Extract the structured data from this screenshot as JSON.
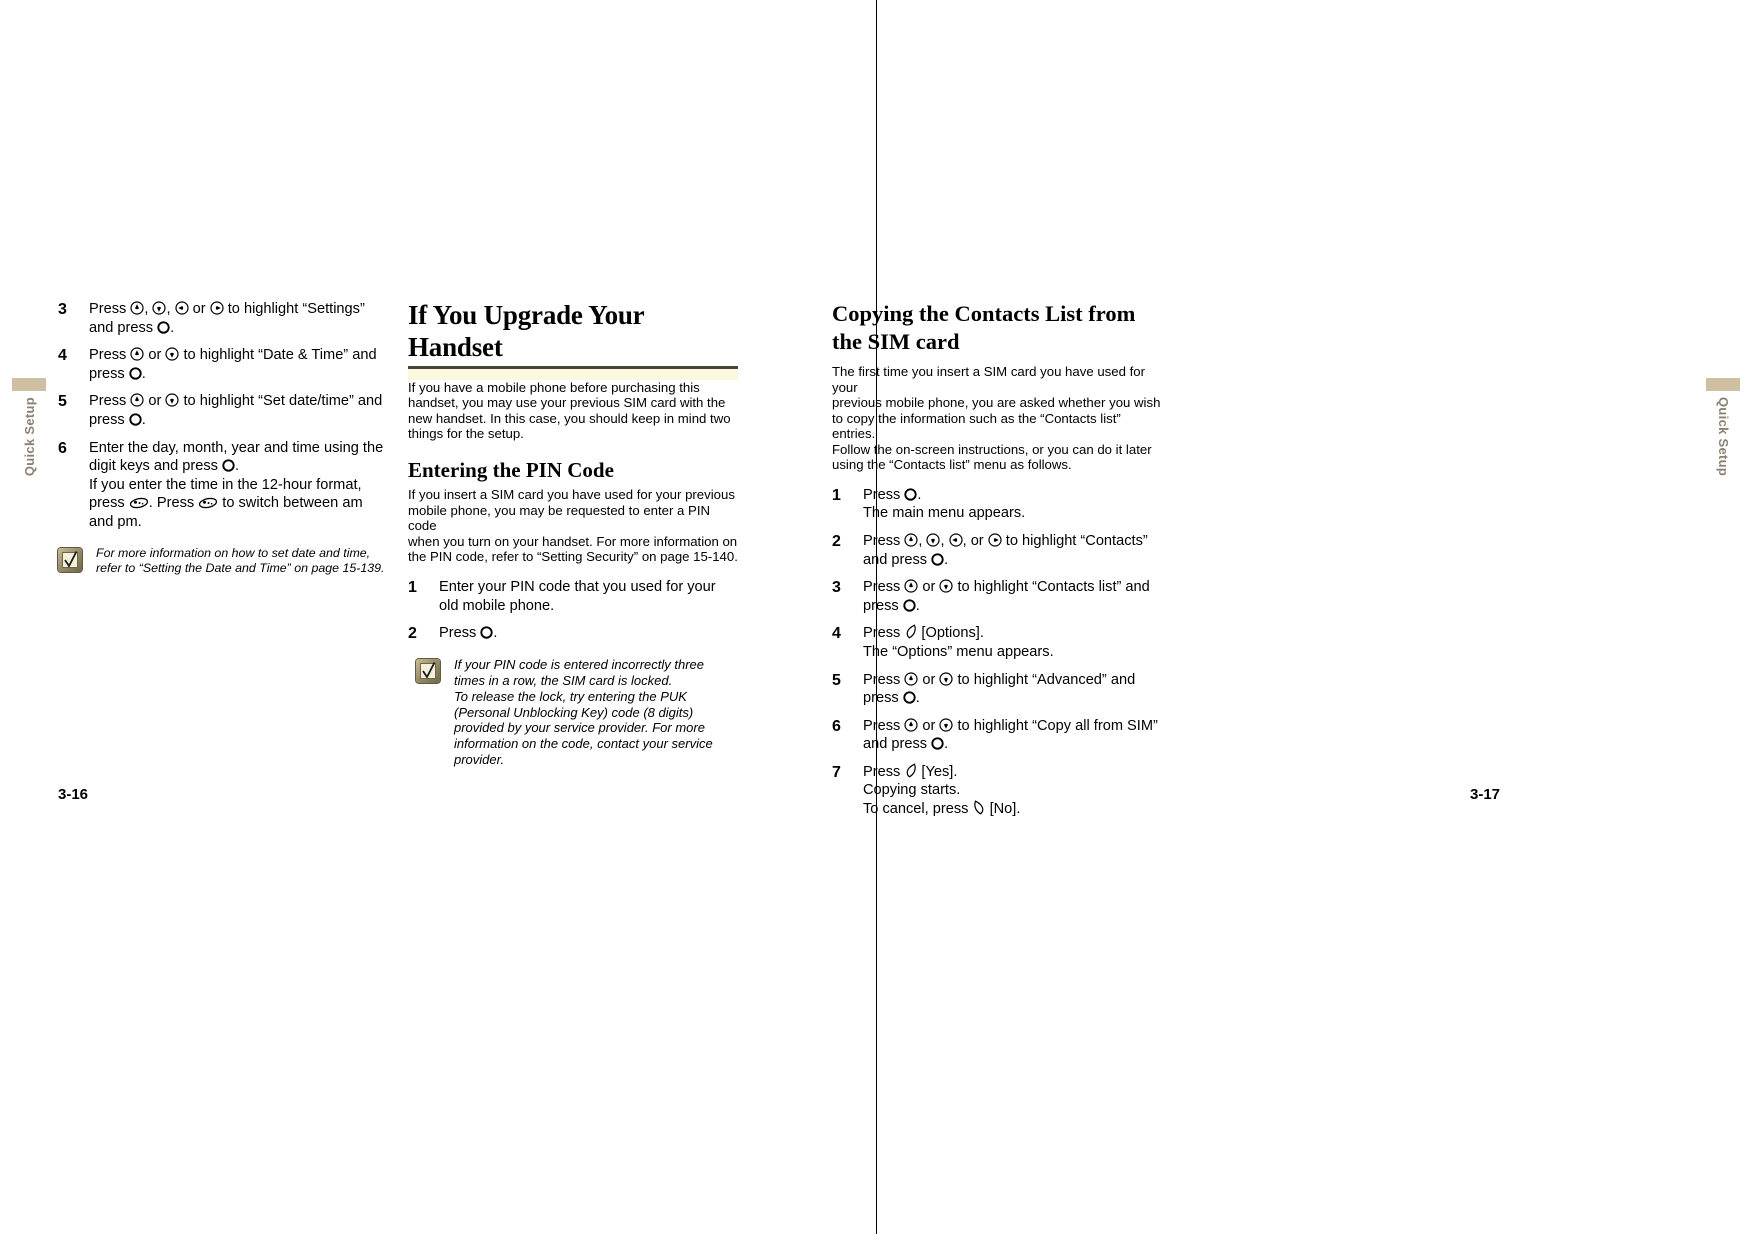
{
  "document": {
    "type": "printed-manual-spread",
    "thumb_tab_label": "Quick Setup",
    "thumb_tab_color": "#cfc0a4",
    "accent_rule_color": "#4a4433",
    "accent_band_color": "#fcf8e0",
    "left_page_number": "3-16",
    "right_page_number": "3-17"
  },
  "left_page": {
    "column_a": {
      "steps": [
        {
          "number": "3",
          "lines": [
            "Press ⓘ, ⓘ, ⓘ or ⓘ to highlight “Settings”",
            "and press ○."
          ],
          "text": "Press [up], [down], [left] or [right] to highlight “Settings” and press [center]."
        },
        {
          "number": "4",
          "text": "Press [up] or [down] to highlight “Date & Time” and press [center]."
        },
        {
          "number": "5",
          "text": "Press [up] or [down] to highlight “Set date/time” and press [center]."
        },
        {
          "number": "6",
          "text": "Enter the day, month, year and time using the digit keys and press [center]. If you enter the time in the 12-hour format, press [star]. Press [star] to switch between am and pm."
        }
      ],
      "note": {
        "icon": "check-note-icon",
        "text": "For more information on how to set date and time, refer to “Setting the Date and Time” on page 15-139."
      }
    },
    "column_b": {
      "heading": "If You Upgrade Your Handset",
      "intro": "If you have a mobile phone before purchasing this handset, you may use your previous SIM card with the new handset. In this case, you should keep in mind two things for the setup.",
      "sub_heading": "Entering the PIN Code",
      "sub_intro": "If you insert a SIM card you have used for your previous mobile phone, you may be requested to enter a PIN code when you turn on your handset. For more information on the PIN code, refer to “Setting Security” on page 15-140.",
      "steps": [
        {
          "number": "1",
          "text": "Enter your PIN code that you used for your old mobile phone."
        },
        {
          "number": "2",
          "text": "Press [center]."
        }
      ],
      "note": {
        "icon": "check-note-icon",
        "text": "If your PIN code is entered incorrectly three times in a row, the SIM card is locked. To release the lock, try entering the PUK (Personal Unblocking Key) code (8 digits) provided by your service provider. For more information on the code, contact your service provider."
      }
    }
  },
  "right_page": {
    "column_c": {
      "heading": "Copying the Contacts List from the SIM card",
      "intro": "The first time you insert a SIM card you have used for your previous mobile phone, you are asked whether you wish to copy the information such as the “Contacts list” entries. Follow the on-screen instructions, or you can do it later using the “Contacts list” menu as follows.",
      "steps": [
        {
          "number": "1",
          "text": "Press [center]. The main menu appears."
        },
        {
          "number": "2",
          "text": "Press [up], [down], [left], or [right] to highlight “Contacts” and press [center]."
        },
        {
          "number": "3",
          "text": "Press [up] or [down] to highlight “Contacts list” and press [center]."
        },
        {
          "number": "4",
          "text": "Press [softkey-left] [Options]. The “Options” menu appears."
        },
        {
          "number": "5",
          "text": "Press [up] or [down] to highlight “Advanced” and press [center]."
        },
        {
          "number": "6",
          "text": "Press [up] or [down] to highlight “Copy all from SIM” and press [center]."
        },
        {
          "number": "7",
          "text": "Press [softkey-left] [Yes]. Copying starts. To cancel, press [softkey-right] [No]."
        }
      ]
    }
  },
  "strings": {
    "press": "Press ",
    "or": " or ",
    "comma": ", ",
    "period": ".",
    "to_highlight": " to highlight ",
    "and_press": "and press ",
    "step3_target": "“Settings”",
    "step3_tail": "and press ",
    "step4_target": "“Date & Time” and",
    "step4_tail": "press ",
    "step5_target": "“Set date/time” and",
    "step5_tail": "press ",
    "step6_l1": "Enter the day, month, year and time using the",
    "step6_l2a": "digit keys and press ",
    "step6_l3": "If you enter the time in the 12-hour format,",
    "step6_l4a": "press ",
    "step6_l4b": ". Press ",
    "step6_l4c": " to switch between am",
    "step6_l5": "and pm.",
    "note_left_l1": "For more information on how to set date and time,",
    "note_left_l2": "refer to “Setting the Date and Time” on page 15-139.",
    "mid_intro_l1": "If you have a mobile phone before purchasing this",
    "mid_intro_l2": "handset, you may use your previous SIM card with the",
    "mid_intro_l3": "new handset. In this case, you should keep in mind two",
    "mid_intro_l4": "things for the setup.",
    "mid_sub_l1": "If you insert a SIM card you have used for your previous",
    "mid_sub_l2": "mobile phone, you may be requested to enter a PIN code",
    "mid_sub_l3": "when you turn on your handset. For more information on",
    "mid_sub_l4": "the PIN code, refer to “Setting Security” on page 15-140.",
    "mid_s1_l1": "Enter your PIN code that you used for your",
    "mid_s1_l2": "old mobile phone.",
    "mid_s2_l1": "Press ",
    "note_mid_l1": "If your PIN code is entered incorrectly three",
    "note_mid_l2": "times in a row, the SIM card is locked.",
    "note_mid_l3": "To release the lock, try entering the PUK",
    "note_mid_l4": "(Personal Unblocking Key) code (8 digits)",
    "note_mid_l5": "provided by your service provider. For more",
    "note_mid_l6": "information on the code, contact your service",
    "note_mid_l7": "provider.",
    "right_intro_l1": "The first time you insert a SIM card you have used for your",
    "right_intro_l2": "previous mobile phone, you are asked whether you wish",
    "right_intro_l3": "to copy the information such as the “Contacts list” entries.",
    "right_intro_l4": "Follow the on-screen instructions, or you can do it later",
    "right_intro_l5": "using the “Contacts list” menu as follows.",
    "r1_l2": "The main menu appears.",
    "r2_target": "“Contacts”",
    "r3_target": "“Contacts list” and",
    "r3_tail": "press ",
    "r4_l1b": " [Options].",
    "r4_l2": "The “Options” menu appears.",
    "r5_target": "“Advanced” and",
    "r5_tail": "press ",
    "r6_target": "“Copy all from SIM”",
    "r6_tail": "and press ",
    "r7_l1b": " [Yes].",
    "r7_l2": "Copying starts.",
    "r7_l3a": "To cancel, press ",
    "r7_l3b": " [No]."
  },
  "icons": {
    "nav_up": "nav-up-key-icon",
    "nav_down": "nav-down-key-icon",
    "nav_left": "nav-left-key-icon",
    "nav_right": "nav-right-key-icon",
    "center": "center-select-key-icon",
    "star": "star-key-icon",
    "softkey_left": "left-softkey-icon",
    "softkey_right": "right-softkey-icon",
    "note_check": "check-note-icon"
  }
}
